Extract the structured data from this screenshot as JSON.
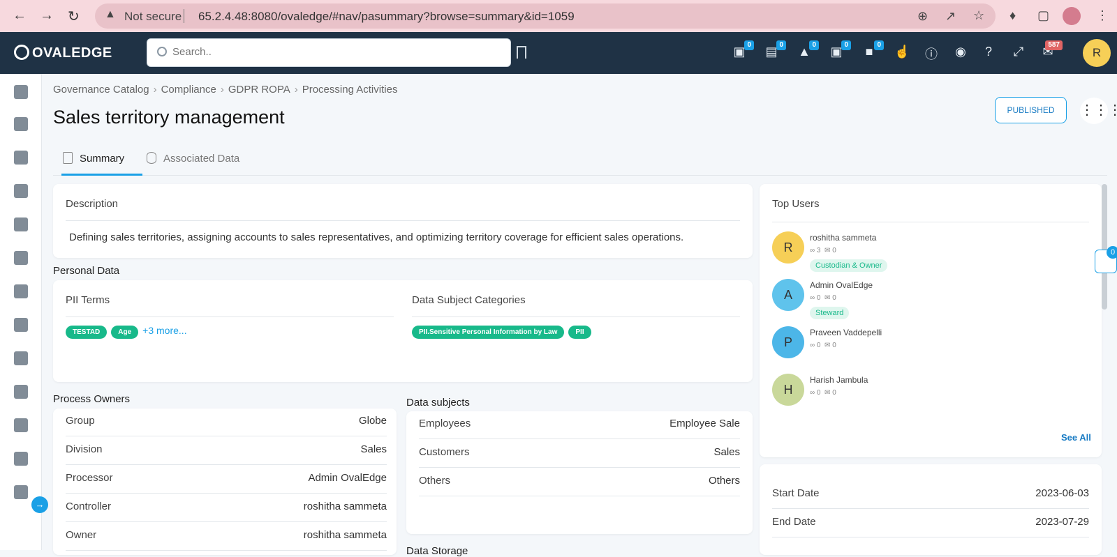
{
  "browser": {
    "not_secure": "Not secure",
    "url": "65.2.4.48:8080/ovaledge/#nav/pasummary?browse=summary&id=1059"
  },
  "app": {
    "logo": "OVALEDGE",
    "search_placeholder": "Search..",
    "header_badges": [
      "0",
      "0",
      "0",
      "0",
      "0"
    ],
    "mail_badge": "587",
    "user_initial": "R"
  },
  "breadcrumb": [
    "Governance Catalog",
    "Compliance",
    "GDPR ROPA",
    "Processing Activities"
  ],
  "page": {
    "title": "Sales territory management",
    "status": "PUBLISHED"
  },
  "tabs": [
    {
      "label": "Summary",
      "active": true
    },
    {
      "label": "Associated Data",
      "active": false
    }
  ],
  "description": {
    "label": "Description",
    "text": "Defining sales territories, assigning accounts to sales representatives, and optimizing territory coverage for efficient sales operations."
  },
  "personal_data": {
    "title": "Personal Data",
    "pii_label": "PII Terms",
    "pii_terms": [
      "TESTAD",
      "Age"
    ],
    "pii_more": "+3 more...",
    "dsc_label": "Data Subject Categories",
    "dsc": [
      "PII.Sensitive Personal Information by Law",
      "PII"
    ]
  },
  "process_owners": {
    "title": "Process Owners",
    "rows": [
      {
        "k": "Group",
        "v": "Globe"
      },
      {
        "k": "Division",
        "v": "Sales"
      },
      {
        "k": "Processor",
        "v": "Admin OvalEdge"
      },
      {
        "k": "Controller",
        "v": "roshitha sammeta"
      },
      {
        "k": "Owner",
        "v": "roshitha sammeta"
      }
    ]
  },
  "data_subjects": {
    "title": "Data subjects",
    "rows": [
      {
        "k": "Employees",
        "v": "Employee Sale"
      },
      {
        "k": "Customers",
        "v": "Sales"
      },
      {
        "k": "Others",
        "v": "Others"
      }
    ],
    "next_title": "Data Storage"
  },
  "top_users": {
    "title": "Top Users",
    "users": [
      {
        "initial": "R",
        "name": "roshitha sammeta",
        "a": "3",
        "b": "0",
        "role": "Custodian & Owner",
        "color": "#f6cf57"
      },
      {
        "initial": "A",
        "name": "Admin OvalEdge",
        "a": "0",
        "b": "0",
        "role": "Steward",
        "color": "#5fc3ec"
      },
      {
        "initial": "P",
        "name": "Praveen Vaddepelli",
        "a": "0",
        "b": "0",
        "role": "",
        "color": "#4cb6e8"
      },
      {
        "initial": "H",
        "name": "Harish Jambula",
        "a": "0",
        "b": "0",
        "role": "",
        "color": "#c9d89a"
      }
    ],
    "see_all": "See All"
  },
  "dates": {
    "start_label": "Start Date",
    "start": "2023-06-03",
    "end_label": "End Date",
    "end": "2023-07-29"
  },
  "chat_badge": "0"
}
